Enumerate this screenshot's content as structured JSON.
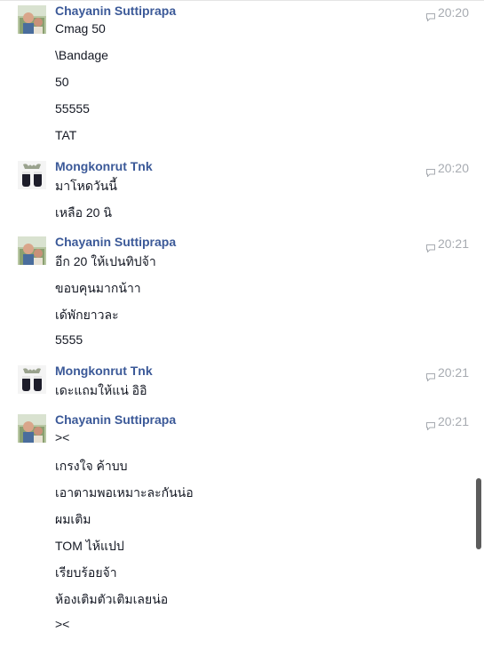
{
  "messages": [
    {
      "sender": "Chayanin Suttiprapa",
      "time": "20:20",
      "avatar": "boy-photo",
      "lines": [
        "Cmag 50",
        "\\Bandage",
        "50",
        "55555",
        "TAT"
      ]
    },
    {
      "sender": "Mongkonrut Tnk",
      "time": "20:20",
      "avatar": "shoes-photo",
      "lines": [
        "มาโหดวันนี้",
        "เหลือ 20 นิ"
      ]
    },
    {
      "sender": "Chayanin Suttiprapa",
      "time": "20:21",
      "avatar": "boy-photo",
      "lines": [
        "อีก 20 ให้เปนทิปจ้า",
        "ขอบคุนมากน้าา",
        "เด้พักยาวละ",
        "5555"
      ]
    },
    {
      "sender": "Mongkonrut Tnk",
      "time": "20:21",
      "avatar": "shoes-photo",
      "lines": [
        "เดะแถมให้แน่ อิอิ"
      ]
    },
    {
      "sender": "Chayanin Suttiprapa",
      "time": "20:21",
      "avatar": "boy-photo",
      "lines": [
        "><",
        "เกรงใจ ค้าบบ",
        "เอาตามพอเหมาะละกันน่อ",
        "ผมเติม",
        "TOM ไห้แปป",
        "เรียบร้อยจ้า",
        "ห้องเติมตัวเติมเลยน่อ",
        "><"
      ]
    }
  ],
  "icons": {
    "timestamp": "chat-bubble-icon"
  },
  "colors": {
    "sender": "#3b5998",
    "time": "#a7abb1",
    "text": "#141823"
  }
}
